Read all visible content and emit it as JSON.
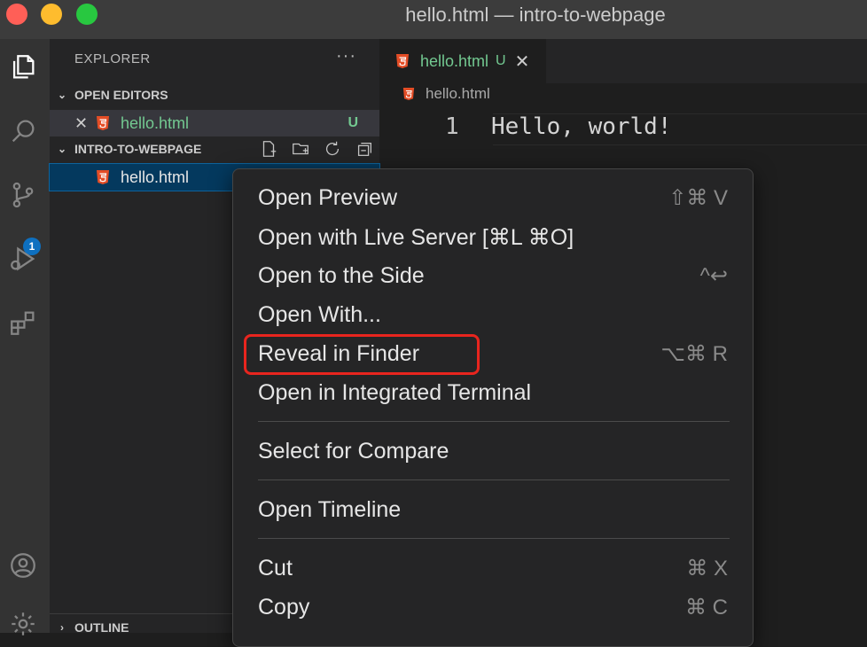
{
  "window": {
    "title": "hello.html — intro-to-webpage"
  },
  "activity_bar": {
    "source_control_badge": "1"
  },
  "sidebar": {
    "title": "EXPLORER",
    "more": "···",
    "open_editors": {
      "header": "OPEN EDITORS",
      "items": [
        {
          "label": "hello.html",
          "status": "U",
          "close": "✕"
        }
      ]
    },
    "folder": {
      "header": "INTRO-TO-WEBPAGE",
      "items": [
        {
          "label": "hello.html"
        }
      ]
    },
    "outline": {
      "header": "OUTLINE"
    }
  },
  "editor": {
    "tab": {
      "label": "hello.html",
      "status": "U",
      "close": "✕"
    },
    "breadcrumb": "hello.html",
    "lines": [
      {
        "number": "1",
        "text": "Hello, world!"
      }
    ]
  },
  "context_menu": {
    "items": [
      {
        "label": "Open Preview",
        "shortcut": "⇧⌘ V"
      },
      {
        "label": "Open with Live Server [⌘L ⌘O]",
        "shortcut": ""
      },
      {
        "label": "Open to the Side",
        "shortcut": "^↩"
      },
      {
        "label": "Open With...",
        "shortcut": ""
      },
      {
        "label": "Reveal in Finder",
        "shortcut": "⌥⌘ R"
      },
      {
        "label": "Open in Integrated Terminal",
        "shortcut": ""
      },
      {
        "label": "Select for Compare",
        "shortcut": ""
      },
      {
        "label": "Open Timeline",
        "shortcut": ""
      },
      {
        "label": "Cut",
        "shortcut": "⌘ X"
      },
      {
        "label": "Copy",
        "shortcut": "⌘ C"
      }
    ]
  },
  "colors": {
    "accent_git_untracked": "#73c991",
    "highlight_box": "#e8251e",
    "selection": "#04395e",
    "html_icon": "#e44d26"
  }
}
